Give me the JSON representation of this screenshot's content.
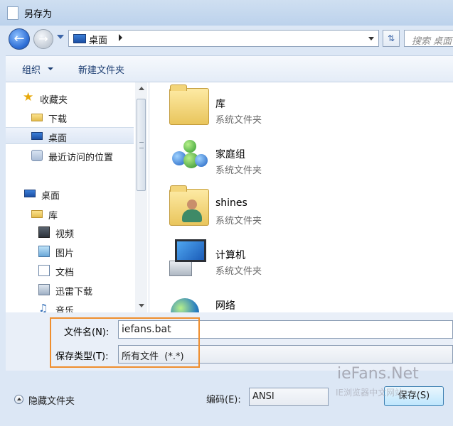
{
  "window": {
    "title": "另存为"
  },
  "address_bar": {
    "crumb": "桌面",
    "search_placeholder": "搜索 桌面"
  },
  "toolbar": {
    "organize_label": "组织",
    "new_folder_label": "新建文件夹"
  },
  "nav_pane": {
    "items": [
      {
        "label": "收藏夹",
        "icon": "star-icon"
      },
      {
        "label": "下载",
        "icon": "download-folder-icon"
      },
      {
        "label": "桌面",
        "icon": "desktop-icon",
        "selected": true
      },
      {
        "label": "最近访问的位置",
        "icon": "recent-places-icon"
      },
      {
        "label": "桌面",
        "icon": "desktop-icon"
      },
      {
        "label": "库",
        "icon": "library-icon"
      },
      {
        "label": "视频",
        "icon": "video-icon"
      },
      {
        "label": "图片",
        "icon": "pictures-icon"
      },
      {
        "label": "文档",
        "icon": "documents-icon"
      },
      {
        "label": "迅雷下载",
        "icon": "download-icon"
      },
      {
        "label": "音乐",
        "icon": "music-icon"
      }
    ]
  },
  "files": [
    {
      "name": "库",
      "type": "系统文件夹",
      "icon": "library-folder-icon"
    },
    {
      "name": "家庭组",
      "type": "系统文件夹",
      "icon": "homegroup-icon"
    },
    {
      "name": "shines",
      "type": "系统文件夹",
      "icon": "user-folder-icon"
    },
    {
      "name": "计算机",
      "type": "系统文件夹",
      "icon": "computer-icon"
    },
    {
      "name": "网络",
      "type": "",
      "icon": "network-icon"
    }
  ],
  "form": {
    "filename_label": "文件名(N):",
    "filename_value": "iefans.bat",
    "filetype_label": "保存类型(T):",
    "filetype_value": "所有文件  (*.*)"
  },
  "footer": {
    "hide_folders_label": "隐藏文件夹",
    "encoding_label": "编码(E):",
    "encoding_value": "ANSI",
    "save_label": "保存(S)"
  },
  "watermark": {
    "brand": "ieFans.Net",
    "sub": "IE浏览器中文网站"
  },
  "colors": {
    "highlight_border": "#ef8e2e",
    "panel_bg": "#dce7f5"
  }
}
